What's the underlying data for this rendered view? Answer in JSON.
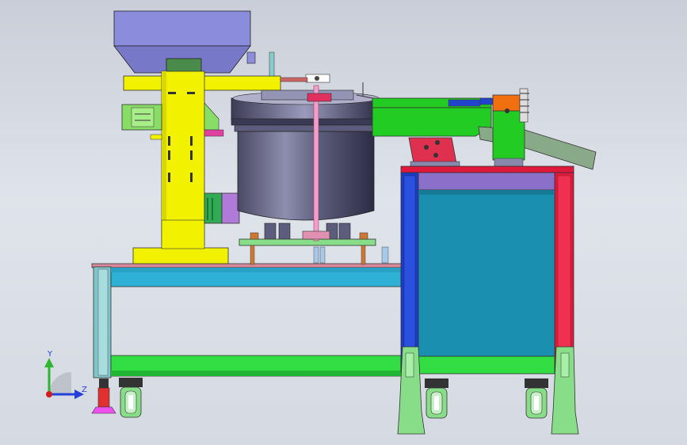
{
  "viewport": {
    "background_top": "#c9ced8",
    "background_bottom": "#d5d9e1"
  },
  "triad": {
    "y_label": "Y",
    "z_label": "Z",
    "y_color": "#2fb52f",
    "z_color": "#2440d8",
    "origin_color": "#d41c1c"
  },
  "model": {
    "colors": {
      "hopper": "#8c8cdc",
      "column": "#f2f200",
      "bowl": "#5a5a7a",
      "frame_green": "#33dd44",
      "frame_blue": "#2fb0d6",
      "cabinet_panel": "#1a8fb0",
      "cabinet_red": "#e0183c",
      "cabinet_blue": "#1a3cc8",
      "chute_green": "#22cc22",
      "orange_block": "#f07010",
      "caster_green": "#88dd88"
    }
  }
}
